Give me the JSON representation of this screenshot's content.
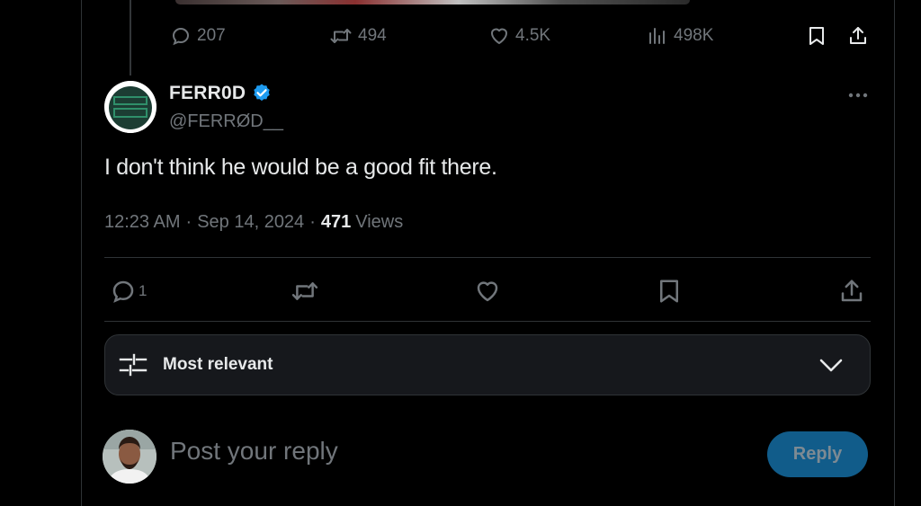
{
  "previous_tweet": {
    "replies": "207",
    "retweets": "494",
    "likes": "4.5K",
    "views": "498K"
  },
  "tweet": {
    "author_name": "FERR0D",
    "handle": "@FERRØD__",
    "text": "I don't think he would be a good fit there.",
    "time": "12:23 AM",
    "date": "Sep 14, 2024",
    "separator": "·",
    "views_count": "471",
    "views_label": "Views",
    "reply_count": "1"
  },
  "sort": {
    "label": "Most relevant"
  },
  "compose": {
    "placeholder": "Post your reply",
    "reply_label": "Reply"
  },
  "colors": {
    "background": "#000000",
    "text": "#e7e9ea",
    "muted": "#71767b",
    "verified": "#1d9bf0",
    "reply_button": "#115c8a"
  },
  "icons": [
    "reply-icon",
    "retweet-icon",
    "like-icon",
    "views-icon",
    "bookmark-icon",
    "share-icon",
    "verified-icon",
    "more-icon",
    "sort-sliders-icon",
    "chevron-down-icon"
  ]
}
